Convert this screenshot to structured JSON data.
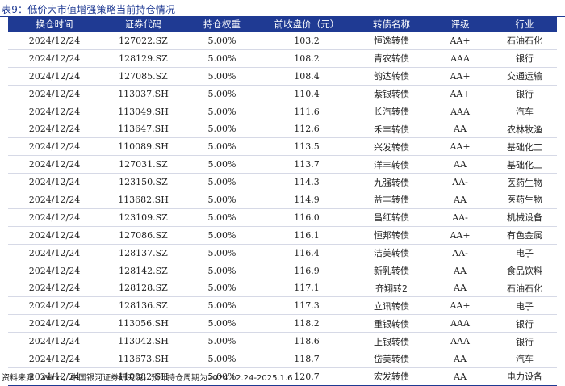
{
  "caption": "表9：低价大市值增强策略当前持仓情况",
  "columns": [
    "换仓时间",
    "证券代码",
    "持仓权重",
    "前收盘价（元）",
    "转债名称",
    "评级",
    "行业"
  ],
  "rows": [
    [
      "2024/12/24",
      "127022.SZ",
      "5.00%",
      "103.2",
      "恒逸转债",
      "AA+",
      "石油石化"
    ],
    [
      "2024/12/24",
      "128129.SZ",
      "5.00%",
      "108.2",
      "青农转债",
      "AAA",
      "银行"
    ],
    [
      "2024/12/24",
      "127085.SZ",
      "5.00%",
      "108.4",
      "韵达转债",
      "AA+",
      "交通运输"
    ],
    [
      "2024/12/24",
      "113037.SH",
      "5.00%",
      "110.4",
      "紫银转债",
      "AA+",
      "银行"
    ],
    [
      "2024/12/24",
      "113049.SH",
      "5.00%",
      "111.6",
      "长汽转债",
      "AAA",
      "汽车"
    ],
    [
      "2024/12/24",
      "113647.SH",
      "5.00%",
      "112.6",
      "禾丰转债",
      "AA",
      "农林牧渔"
    ],
    [
      "2024/12/24",
      "110089.SH",
      "5.00%",
      "113.5",
      "兴发转债",
      "AA+",
      "基础化工"
    ],
    [
      "2024/12/24",
      "127031.SZ",
      "5.00%",
      "113.7",
      "洋丰转债",
      "AA",
      "基础化工"
    ],
    [
      "2024/12/24",
      "123150.SZ",
      "5.00%",
      "114.3",
      "九强转债",
      "AA-",
      "医药生物"
    ],
    [
      "2024/12/24",
      "113682.SH",
      "5.00%",
      "114.9",
      "益丰转债",
      "AA",
      "医药生物"
    ],
    [
      "2024/12/24",
      "123109.SZ",
      "5.00%",
      "116.0",
      "昌红转债",
      "AA-",
      "机械设备"
    ],
    [
      "2024/12/24",
      "127086.SZ",
      "5.00%",
      "116.1",
      "恒邦转债",
      "AA+",
      "有色金属"
    ],
    [
      "2024/12/24",
      "128137.SZ",
      "5.00%",
      "116.4",
      "洁美转债",
      "AA-",
      "电子"
    ],
    [
      "2024/12/24",
      "128142.SZ",
      "5.00%",
      "116.9",
      "新乳转债",
      "AA",
      "食品饮料"
    ],
    [
      "2024/12/24",
      "128128.SZ",
      "5.00%",
      "117.1",
      "齐翔转2",
      "AA",
      "石油石化"
    ],
    [
      "2024/12/24",
      "128136.SZ",
      "5.00%",
      "117.3",
      "立讯转债",
      "AA+",
      "电子"
    ],
    [
      "2024/12/24",
      "113056.SH",
      "5.00%",
      "118.2",
      "重银转债",
      "AAA",
      "银行"
    ],
    [
      "2024/12/24",
      "113042.SH",
      "5.00%",
      "118.6",
      "上银转债",
      "AAA",
      "银行"
    ],
    [
      "2024/12/24",
      "113673.SH",
      "5.00%",
      "118.7",
      "岱美转债",
      "AA",
      "汽车"
    ],
    [
      "2024/12/24",
      "110082.SH",
      "5.00%",
      "120.7",
      "宏发转债",
      "AA",
      "电力设备"
    ]
  ],
  "source": "资料来源：Wind，中国银河证券研究院，预计持仓周期为2024.12.24-2025.1.6",
  "colors": {
    "accent": "#1f3a93",
    "row_rule": "#d6d9e6"
  }
}
